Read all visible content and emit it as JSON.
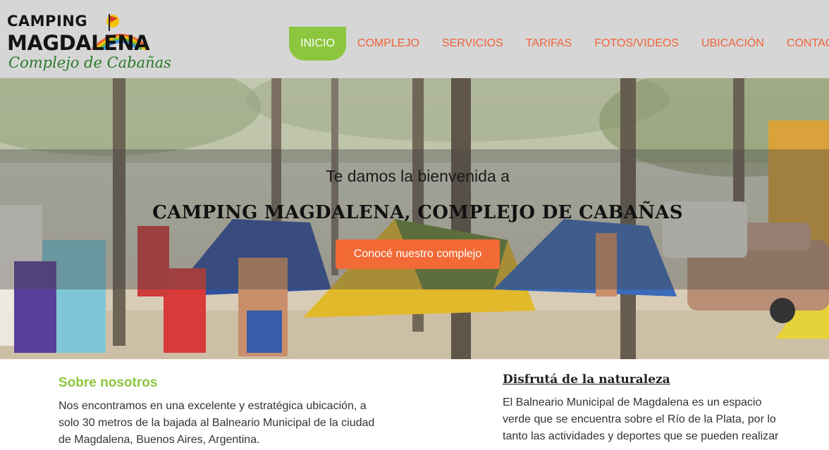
{
  "logo": {
    "line1": "CAMPING",
    "line2": "MAGDALENA",
    "line3": "Complejo de Cabañas"
  },
  "nav": {
    "items": [
      {
        "label": "INICIO",
        "active": true
      },
      {
        "label": "COMPLEJO"
      },
      {
        "label": "SERVICIOS"
      },
      {
        "label": "TARIFAS"
      },
      {
        "label": "FOTOS/VIDEOS"
      },
      {
        "label": "UBICACIÓN"
      },
      {
        "label": "CONTACTO"
      }
    ]
  },
  "hero": {
    "welcome": "Te damos la bienvenida a",
    "title": "CAMPING MAGDALENA, COMPLEJO DE CABAÑAS",
    "button_label": "Conocé nuestro complejo"
  },
  "about": {
    "title": "Sobre nosotros",
    "text": "Nos encontramos en una excelente y estratégica ubicación, a solo 30 metros de la bajada al Balneario Municipal de la ciudad de Magdalena, Buenos Aires, Argentina."
  },
  "nature": {
    "title": "Disfrutá de la naturaleza",
    "text": "El Balneario Municipal de Magdalena es un espacio verde que se encuentra sobre el Río de la Plata, por lo tanto las actividades y deportes que se pueden realizar"
  },
  "colors": {
    "header_bg": "#d6d6d6",
    "nav_text": "#f0633a",
    "nav_active_bg": "#8cc63f",
    "accent_green": "#8cc63f",
    "button_bg": "#f26a36"
  }
}
